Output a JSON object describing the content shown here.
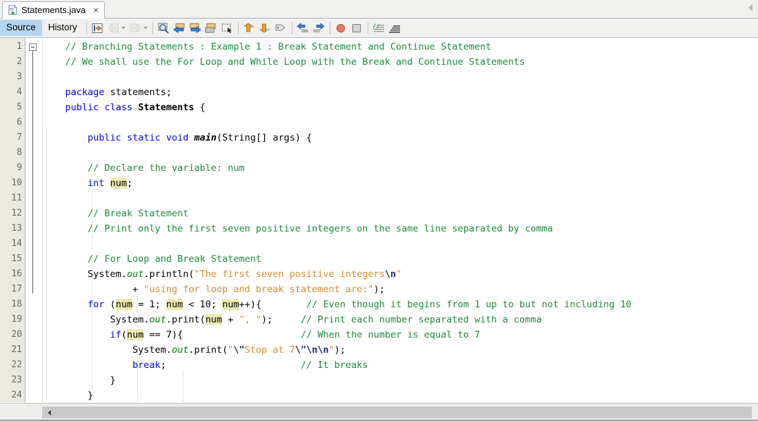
{
  "window": {
    "collapse_icon": "collapse-left-arrow"
  },
  "tab": {
    "filename": "Statements.java",
    "file_icon": "java-file-icon",
    "close_label": "×"
  },
  "toolbar": {
    "view_tabs": [
      {
        "label": "Source",
        "selected": true
      },
      {
        "label": "History",
        "selected": false
      }
    ],
    "buttons": [
      {
        "name": "last-edit-position-icon",
        "glyph": "↵"
      },
      {
        "name": "back-icon",
        "glyph": "⇐"
      },
      {
        "name": "forward-icon",
        "glyph": "⇒"
      },
      {
        "name": "find-selection-icon",
        "glyph": "⌕"
      },
      {
        "name": "find-previous-icon",
        "glyph": "←"
      },
      {
        "name": "find-next-icon",
        "glyph": "→"
      },
      {
        "name": "toggle-highlight-icon",
        "glyph": "▤"
      },
      {
        "name": "toggle-rectangular-selection-icon",
        "glyph": "⬚"
      },
      {
        "name": "previous-bookmark-icon",
        "glyph": "↑"
      },
      {
        "name": "next-bookmark-icon",
        "glyph": "↓"
      },
      {
        "name": "toggle-bookmark-icon",
        "glyph": "⚑"
      },
      {
        "name": "shift-left-icon",
        "glyph": "⇤"
      },
      {
        "name": "shift-right-icon",
        "glyph": "⇥"
      },
      {
        "name": "toggle-breakpoint-icon",
        "glyph": "●"
      },
      {
        "name": "stop-icon",
        "glyph": "■"
      },
      {
        "name": "comment-icon",
        "glyph": "≡"
      },
      {
        "name": "uncomment-icon",
        "glyph": "≡"
      }
    ]
  },
  "editor": {
    "line_numbers": [
      1,
      2,
      3,
      4,
      5,
      6,
      7,
      8,
      9,
      10,
      11,
      12,
      13,
      14,
      15,
      16,
      17,
      18,
      19,
      20,
      21,
      22,
      23,
      24
    ],
    "fold_marker_line": 7,
    "lines": [
      "    // Branching Statements : Example 1 : Break Statement and Continue Statement",
      "    // We shall use the For Loop and While Loop with the Break and Continue Statements",
      "",
      "    package statements;",
      "    public class Statements {",
      "",
      "        public static void main(String[] args) {",
      "",
      "        // Declare the variable: num",
      "        int num;",
      "",
      "        // Break Statement",
      "        // Print only the first seven positive integers on the same line separated by comma",
      "",
      "        // For Loop and Break Statement",
      "        System.out.println(\"The first seven positive integers\\n\"",
      "                + \"using for loop and break statement are:\");",
      "        for (num = 1; num < 10; num++){        // Even though it begins from 1 up to but not including 10",
      "            System.out.print(num + \", \");     // Print each number separated with a comma",
      "            if(num == 7){                     // When the number is equal to 7",
      "                System.out.print(\"\\\"Stop at 7\\\"\\n\\n\");",
      "                break;                        // It breaks",
      "            }",
      "        }"
    ],
    "highlighted_token": "num",
    "colors": {
      "comment": "#1b8a3a",
      "keyword": "#0000e6",
      "string": "#d9892b",
      "escape": "#1a237e",
      "field": "#008000",
      "highlight": "#ecebb0",
      "gutter_bg": "#e9e9e2",
      "selected_tab_bg": "#b5d4f0"
    }
  },
  "scrollbar": {
    "left_arrow": "scroll-left-arrow"
  }
}
